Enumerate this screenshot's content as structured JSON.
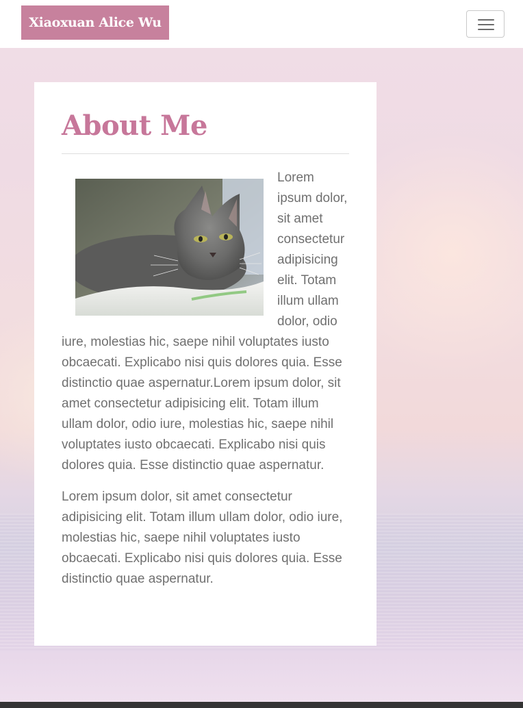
{
  "navbar": {
    "brand": "Xiaoxuan Alice Wu",
    "toggle_icon": "hamburger-menu-icon"
  },
  "about": {
    "title": "About Me",
    "image_alt": "cat",
    "paragraphs": [
      "Lorem ipsum dolor, sit amet consectetur adipisicing elit. Totam illum ullam dolor, odio iure, molestias hic, saepe nihil voluptates iusto obcaecati. Explicabo nisi quis dolores quia. Esse distinctio quae aspernatur.Lorem ipsum dolor, sit amet consectetur adipisicing elit. Totam illum ullam dolor, odio iure, molestias hic, saepe nihil voluptates iusto obcaecati. Explicabo nisi quis dolores quia. Esse distinctio quae aspernatur.",
      "Lorem ipsum dolor, sit amet consectetur adipisicing elit. Totam illum ullam dolor, odio iure, molestias hic, saepe nihil voluptates iusto obcaecati. Explicabo nisi quis dolores quia. Esse distinctio quae aspernatur."
    ]
  },
  "colors": {
    "brand_bg": "#c7819d",
    "heading": "#c7779a",
    "body_text": "#707070",
    "footer": "#343434"
  }
}
